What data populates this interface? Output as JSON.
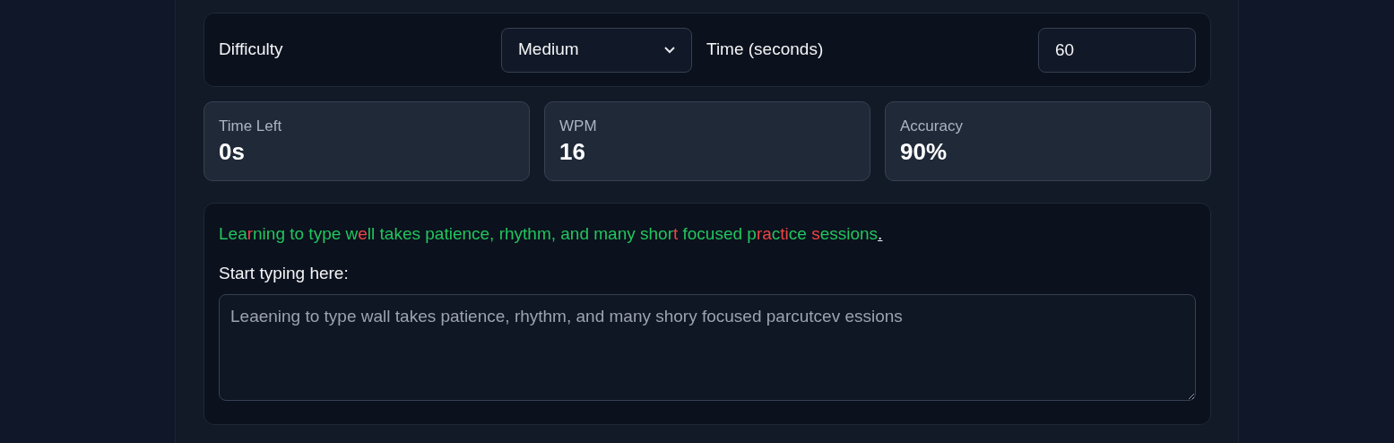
{
  "settings": {
    "difficulty_label": "Difficulty",
    "difficulty_value": "Medium",
    "time_label": "Time (seconds)",
    "time_value": "60"
  },
  "stats": [
    {
      "label": "Time Left",
      "value": "0s"
    },
    {
      "label": "WPM",
      "value": "16"
    },
    {
      "label": "Accuracy",
      "value": "90%"
    }
  ],
  "passage": [
    {
      "text": "Lea",
      "kind": "correct"
    },
    {
      "text": "r",
      "kind": "wrong"
    },
    {
      "text": "ning to type w",
      "kind": "correct"
    },
    {
      "text": "e",
      "kind": "wrong"
    },
    {
      "text": "ll takes patience, rhythm, and many shor",
      "kind": "correct"
    },
    {
      "text": "t",
      "kind": "wrong"
    },
    {
      "text": " focused p",
      "kind": "correct"
    },
    {
      "text": "ra",
      "kind": "wrong"
    },
    {
      "text": "c",
      "kind": "correct"
    },
    {
      "text": "ti",
      "kind": "wrong"
    },
    {
      "text": "ce",
      "kind": "correct"
    },
    {
      "text": " s",
      "kind": "wrong"
    },
    {
      "text": "essions",
      "kind": "correct"
    },
    {
      "text": ".",
      "kind": "current"
    }
  ],
  "input": {
    "label": "Start typing here:",
    "value": "Leaening to type wall takes patience, rhythm, and many shory focused parcutcev essions"
  }
}
